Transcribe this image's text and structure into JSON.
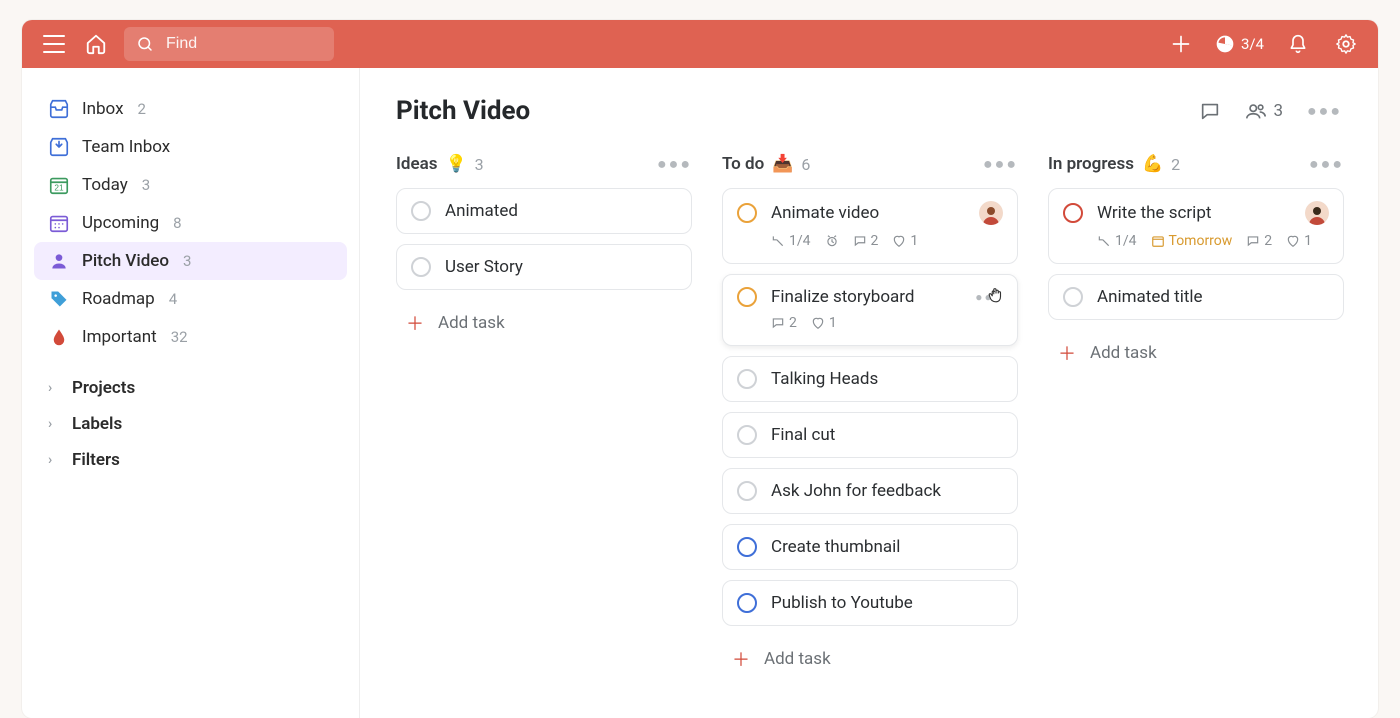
{
  "header": {
    "search_placeholder": "Find",
    "progress": "3/4"
  },
  "sidebar": {
    "items": [
      {
        "label": "Inbox",
        "count": "2"
      },
      {
        "label": "Team Inbox",
        "count": ""
      },
      {
        "label": "Today",
        "count": "3"
      },
      {
        "label": "Upcoming",
        "count": "8"
      },
      {
        "label": "Pitch Video",
        "count": "3"
      },
      {
        "label": "Roadmap",
        "count": "4"
      },
      {
        "label": "Important",
        "count": "32"
      }
    ],
    "groups": [
      {
        "label": "Projects"
      },
      {
        "label": "Labels"
      },
      {
        "label": "Filters"
      }
    ]
  },
  "page": {
    "title": "Pitch Video",
    "members": "3"
  },
  "columns": [
    {
      "title": "Ideas",
      "emoji": "💡",
      "count": "3",
      "add_label": "Add task",
      "cards": [
        {
          "title": "Animated",
          "check": ""
        },
        {
          "title": "User Story",
          "check": ""
        }
      ]
    },
    {
      "title": "To do",
      "emoji": "📥",
      "count": "6",
      "add_label": "Add task",
      "cards": [
        {
          "title": "Animate video",
          "check": "orange",
          "avatar": true,
          "meta": {
            "subtasks": "1/4",
            "reminder": true,
            "comments": "2",
            "likes": "1"
          }
        },
        {
          "title": "Finalize storyboard",
          "check": "orange",
          "hover": true,
          "meta": {
            "comments": "2",
            "likes": "1"
          }
        },
        {
          "title": "Talking Heads",
          "check": ""
        },
        {
          "title": "Final cut",
          "check": ""
        },
        {
          "title": "Ask John for feedback",
          "check": ""
        },
        {
          "title": "Create thumbnail",
          "check": "blue"
        },
        {
          "title": "Publish to Youtube",
          "check": "blue"
        }
      ]
    },
    {
      "title": "In progress",
      "emoji": "💪",
      "count": "2",
      "add_label": "Add task",
      "cards": [
        {
          "title": "Write the script",
          "check": "red",
          "avatar": true,
          "meta": {
            "subtasks": "1/4",
            "due": "Tomorrow",
            "comments": "2",
            "likes": "1"
          }
        },
        {
          "title": "Animated title",
          "check": ""
        }
      ]
    }
  ]
}
